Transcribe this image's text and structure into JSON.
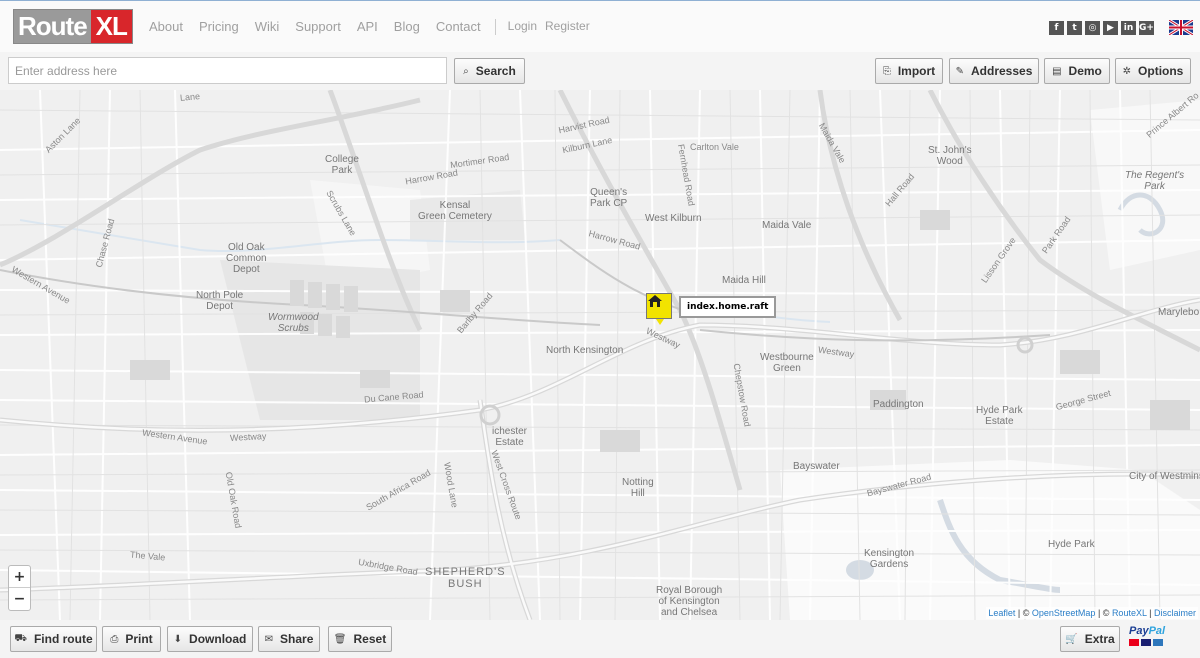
{
  "logo": {
    "route": "Route",
    "xl": "XL"
  },
  "nav": {
    "items": [
      "About",
      "Pricing",
      "Wiki",
      "Support",
      "API",
      "Blog",
      "Contact"
    ],
    "login": "Login",
    "register": "Register"
  },
  "social": [
    "f",
    "t",
    "◎",
    "▶",
    "in",
    "G+"
  ],
  "search": {
    "placeholder": "Enter address here",
    "value": "",
    "button": "Search"
  },
  "actions": {
    "import": "Import",
    "addresses": "Addresses",
    "demo": "Demo",
    "options": "Options"
  },
  "map": {
    "marker_label": "index.home.raft",
    "zoom_in": "+",
    "zoom_out": "−",
    "attribution": {
      "leaflet": "Leaflet",
      "osm": "OpenStreetMap",
      "routexl": "RouteXL",
      "disclaimer": "Disclaimer",
      "sep1": " | © ",
      "sep2": " | © ",
      "sep3": " | "
    },
    "labels": {
      "college_park": "College\nPark",
      "kensal": "Kensal\nGreen Cemetery",
      "queens_park": "Queen's\nPark CP",
      "west_kilburn": "West Kilburn",
      "maida_vale": "Maida Vale",
      "maida_hill": "Maida Hill",
      "old_oak": "Old Oak\nCommon\nDepot",
      "north_pole": "North Pole\nDepot",
      "wormwood": "Wormwood\nScrubs",
      "north_kensington": "North Kensington",
      "westbourne": "Westbourne\nGreen",
      "paddington": "Paddington",
      "hyde_park_estate": "Hyde Park\nEstate",
      "bayswater": "Bayswater",
      "notting_hill": "Notting\nHill",
      "chester_estate": "ichester\nEstate",
      "shepherds_bush": "SHEPHERD'S\nBUSH",
      "royal_borough": "Royal Borough\nof Kensington\nand Chelsea",
      "kensington_gardens": "Kensington\nGardens",
      "hyde_park": "Hyde Park",
      "city_westminster": "City of Westminst",
      "st_johns_wood": "St. John's\nWood",
      "regents_park": "The Regent's\nPark",
      "marylebone": "Marylebo",
      "harrow_road": "Harrow Road",
      "harrow_road2": "Harrow Road",
      "westway": "Westway",
      "westway2": "Westway",
      "westway3": "Westway",
      "western_avenue": "Western Avenue",
      "western_avenue2": "Western Avenue",
      "ducane": "Du Cane Road",
      "uxbridge": "Uxbridge Road",
      "bayswater_road": "Bayswater Road",
      "george_street": "George Street",
      "kilburn_lane": "Kilburn Lane",
      "mortimer": "Mortimer Road",
      "harvist": "Harvist Road",
      "carlton": "Carlton Vale",
      "fernhead": "Fernhead Road",
      "chase_road": "Chase Road",
      "scrubs_lane": "Scrubs Lane",
      "bartby": "Barlby Road",
      "old_oak_road": "Old Oak Road",
      "south_africa": "South Africa Road",
      "wood_lane": "Wood Lane",
      "west_cross": "West Cross Route",
      "chepstow": "Chepstow Road",
      "hall_road": "Hall Road",
      "lisson": "Lisson Grove",
      "park_road": "Park Road",
      "maida_vale_road": "Maida Vale",
      "prince_albert": "Prince Albert Ro",
      "the_vale": "The Vale",
      "aston": "Aston Lane",
      "kilburn_lane2": "Lane"
    }
  },
  "bottom": {
    "find_route": "Find route",
    "print": "Print",
    "download": "Download",
    "share": "Share",
    "reset": "Reset",
    "extra": "Extra"
  },
  "paypal": {
    "pay": "Pay",
    "pal": "Pal"
  }
}
